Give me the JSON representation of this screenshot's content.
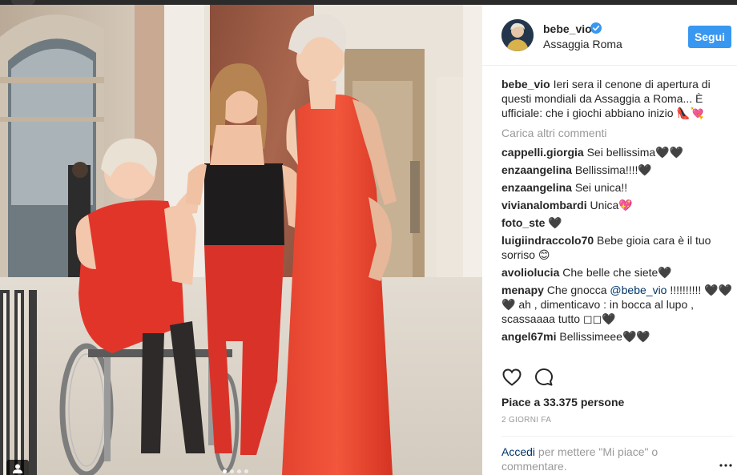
{
  "post": {
    "username": "bebe_vio",
    "location": "Assaggia Roma",
    "follow_label": "Segui",
    "caption": {
      "user": "bebe_vio",
      "text": "Ieri sera il cenone di apertura di questi mondiali da Assaggia a Roma... È ufficiale: che i giochi abbiano inizio 👠💘"
    },
    "load_more_label": "Carica altri commenti",
    "comments": [
      {
        "user": "cappelli.giorgia",
        "text": "Sei bellissima🖤🖤"
      },
      {
        "user": "enzaangelina",
        "text": "Bellissima!!!!🖤"
      },
      {
        "user": "enzaangelina",
        "text": "Sei unica!!"
      },
      {
        "user": "vivianalombardi",
        "text": "Unica💖"
      },
      {
        "user": "foto_ste",
        "text": "🖤"
      },
      {
        "user": "luigiindraccolo70",
        "text": "Bebe gioia cara è il tuo sorriso 😊"
      },
      {
        "user": "avoliolucia",
        "text": "Che belle che siete🖤"
      },
      {
        "user": "menapy",
        "text_before": "Che gnocca ",
        "mention": "@bebe_vio",
        "text_after": " !!!!!!!!!! 🖤🖤🖤 ah , dimenticavo : in bocca al lupo , scassaaaa tutto ◻◻🖤"
      },
      {
        "user": "angel67mi",
        "text": "Bellissimeee🖤🖤"
      }
    ],
    "likes_text": "Piace a 33.375 persone",
    "timestamp": "2 GIORNI FA",
    "login_link": "Accedi",
    "login_text": " per mettere \"Mi piace\" o commentare.",
    "carousel_dots": 4,
    "carousel_active": 0
  },
  "icons": {
    "verified": "verified-badge-icon",
    "like": "heart-icon",
    "comment": "comment-bubble-icon",
    "more": "more-options-icon",
    "user_tag": "user-tag-icon"
  },
  "colors": {
    "follow_button": "#3897f0",
    "verified": "#3897f0",
    "link": "#003569",
    "muted": "#999999",
    "dress_red": "#e0372e"
  }
}
